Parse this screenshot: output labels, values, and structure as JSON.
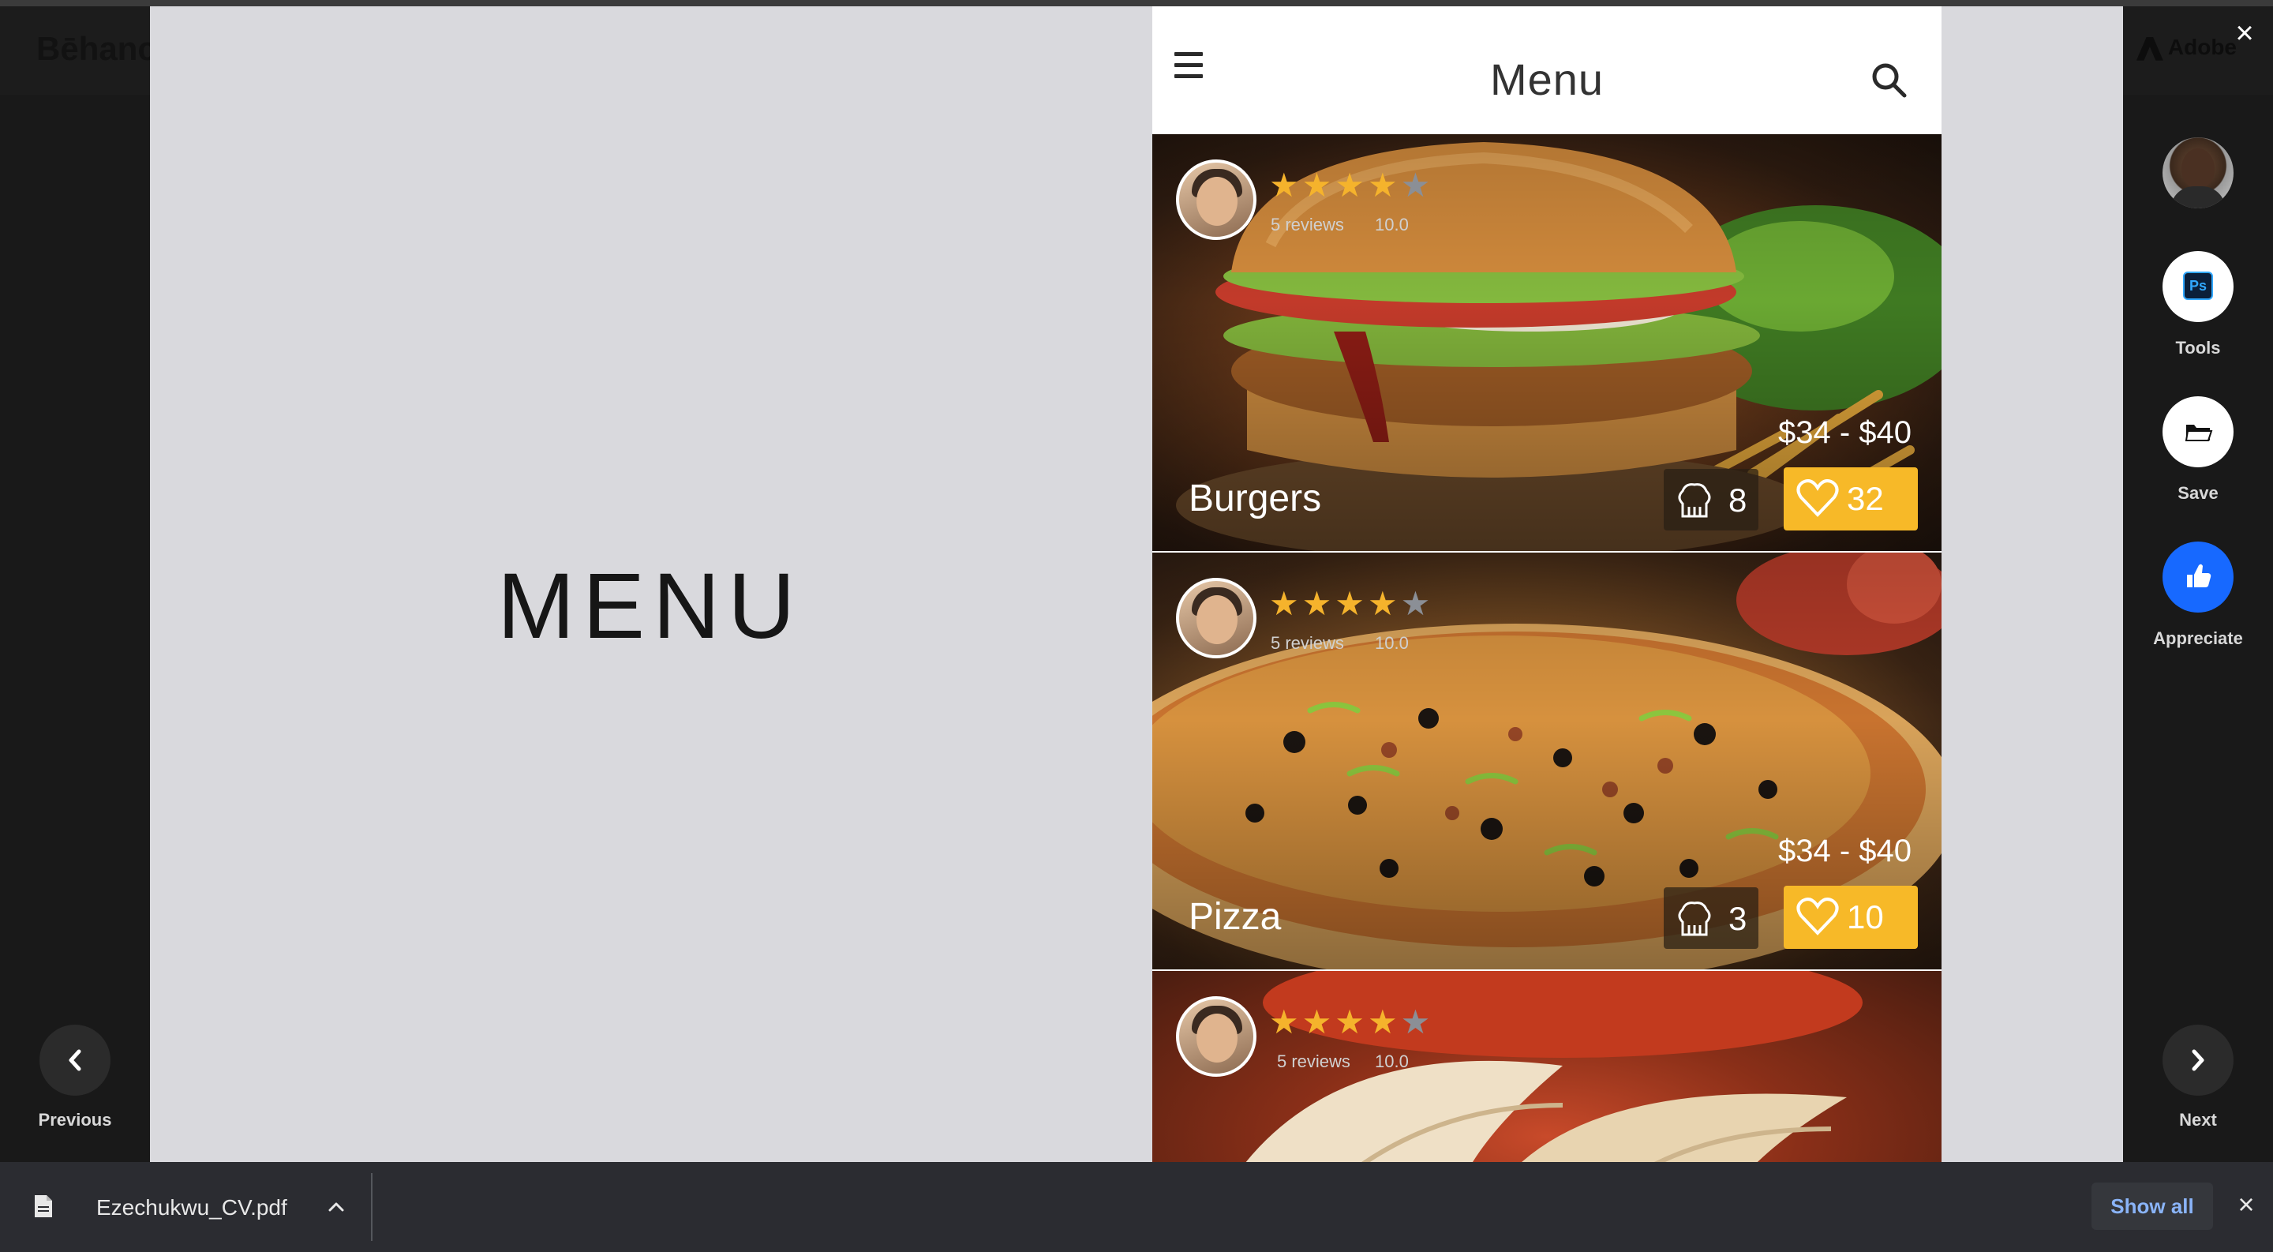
{
  "site": {
    "brand": "Bēhance",
    "adobe_label": "Adobe"
  },
  "lightbox": {
    "close_icon": "×"
  },
  "canvas": {
    "headline": "MENU"
  },
  "phone": {
    "title": "Menu",
    "cards": [
      {
        "dish": "Burgers",
        "price": "$34 - $40",
        "reviews": "5 reviews",
        "rating": "10.0",
        "stars": 4,
        "chefs": "8",
        "likes": "32"
      },
      {
        "dish": "Pizza",
        "price": "$34 - $40",
        "reviews": "5 reviews",
        "rating": "10.0",
        "stars": 4,
        "chefs": "3",
        "likes": "10"
      },
      {
        "dish": "",
        "price": "",
        "reviews": "5 reviews",
        "rating": "10.0",
        "stars": 4,
        "chefs": "",
        "likes": ""
      }
    ]
  },
  "rail": {
    "tools_label": "Tools",
    "tools_badge": "Ps",
    "save_label": "Save",
    "appreciate_label": "Appreciate",
    "accent": "#1769ff"
  },
  "nav": {
    "previous_label": "Previous",
    "next_label": "Next"
  },
  "downloads": {
    "file_name": "Ezechukwu_CV.pdf",
    "show_all": "Show all"
  }
}
